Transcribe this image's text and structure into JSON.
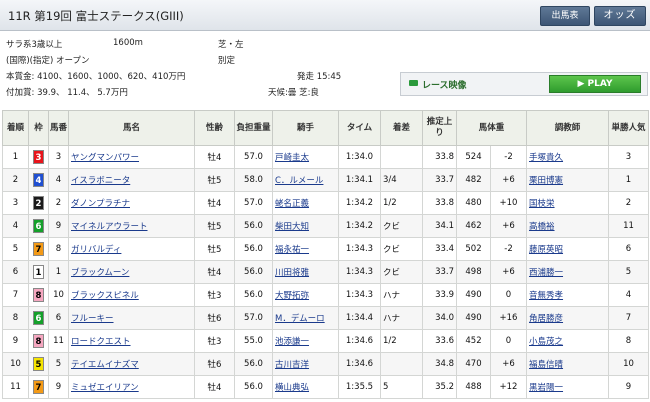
{
  "header": {
    "race_title": "11R 第19回 富士ステークス(GIII)",
    "buttons": {
      "shutuba": "出馬表",
      "odds": "オッズ"
    }
  },
  "race_info": {
    "condition": "サラ系3歳以上",
    "distance": "1600m",
    "course": "芝・左",
    "class": "(国際)(指定) オープン",
    "weight_rule": "別定",
    "prize": "本賞金:  4100、1600、1000、620、410万円",
    "start_time": "発走 15:45",
    "add_prize": "付加賞:   39.9、 11.4、  5.7万円",
    "going": "天候:曇   芝:良"
  },
  "video": {
    "label": "レース映像",
    "play": "PLAY"
  },
  "table": {
    "headers": [
      "着順",
      "枠",
      "馬番",
      "馬名",
      "性齢",
      "負担重量",
      "騎手",
      "タイム",
      "着差",
      "推定上り",
      "馬体重",
      "",
      "調教師",
      "単勝人気"
    ],
    "rows": [
      {
        "rank": "1",
        "waku": "3",
        "umaban": "3",
        "horse": "ヤングマンパワー",
        "sex_age": "牡4",
        "weight": "57.0",
        "jockey": "戸崎圭太",
        "time": "1:34.0",
        "margin": "",
        "last3f": "33.8",
        "body": "524",
        "diff": "-2",
        "trainer": "手塚貴久",
        "pop": "3"
      },
      {
        "rank": "2",
        "waku": "4",
        "umaban": "4",
        "horse": "イスラボニータ",
        "sex_age": "牡5",
        "weight": "58.0",
        "jockey": "C．ルメール",
        "time": "1:34.1",
        "margin": "3/4",
        "last3f": "33.7",
        "body": "482",
        "diff": "+6",
        "trainer": "栗田博憲",
        "pop": "1"
      },
      {
        "rank": "3",
        "waku": "2",
        "umaban": "2",
        "horse": "ダノンプラチナ",
        "sex_age": "牡4",
        "weight": "57.0",
        "jockey": "蛯名正義",
        "time": "1:34.2",
        "margin": "1/2",
        "last3f": "33.8",
        "body": "480",
        "diff": "+10",
        "trainer": "国枝栄",
        "pop": "2"
      },
      {
        "rank": "4",
        "waku": "6",
        "umaban": "9",
        "horse": "マイネルアウラート",
        "sex_age": "牡5",
        "weight": "56.0",
        "jockey": "柴田大知",
        "time": "1:34.2",
        "margin": "クビ",
        "last3f": "34.1",
        "body": "462",
        "diff": "+6",
        "trainer": "高橋裕",
        "pop": "11"
      },
      {
        "rank": "5",
        "waku": "7",
        "umaban": "8",
        "horse": "ガリバルディ",
        "sex_age": "牡5",
        "weight": "56.0",
        "jockey": "福永祐一",
        "time": "1:34.3",
        "margin": "クビ",
        "last3f": "33.4",
        "body": "502",
        "diff": "-2",
        "trainer": "藤原英昭",
        "pop": "6"
      },
      {
        "rank": "6",
        "waku": "1",
        "umaban": "1",
        "horse": "ブラックムーン",
        "sex_age": "牡4",
        "weight": "56.0",
        "jockey": "川田将雅",
        "time": "1:34.3",
        "margin": "クビ",
        "last3f": "33.7",
        "body": "498",
        "diff": "+6",
        "trainer": "西浦勝一",
        "pop": "5"
      },
      {
        "rank": "7",
        "waku": "8",
        "umaban": "10",
        "horse": "ブラックスピネル",
        "sex_age": "牡3",
        "weight": "56.0",
        "jockey": "大野拓弥",
        "time": "1:34.3",
        "margin": "ハナ",
        "last3f": "33.9",
        "body": "490",
        "diff": "0",
        "trainer": "音無秀孝",
        "pop": "4"
      },
      {
        "rank": "8",
        "waku": "6",
        "umaban": "6",
        "horse": "フルーキー",
        "sex_age": "牡6",
        "weight": "57.0",
        "jockey": "M．デムーロ",
        "time": "1:34.4",
        "margin": "ハナ",
        "last3f": "34.0",
        "body": "490",
        "diff": "+16",
        "trainer": "角居勝彦",
        "pop": "7"
      },
      {
        "rank": "9",
        "waku": "8",
        "umaban": "11",
        "horse": "ロードクエスト",
        "sex_age": "牡3",
        "weight": "55.0",
        "jockey": "池添謙一",
        "time": "1:34.6",
        "margin": "1/2",
        "last3f": "33.6",
        "body": "452",
        "diff": "0",
        "trainer": "小島茂之",
        "pop": "8"
      },
      {
        "rank": "10",
        "waku": "5",
        "umaban": "5",
        "horse": "テイエムイナズマ",
        "sex_age": "牡6",
        "weight": "56.0",
        "jockey": "古川吉洋",
        "time": "1:34.6",
        "margin": "",
        "last3f": "34.8",
        "body": "470",
        "diff": "+6",
        "trainer": "福島信晴",
        "pop": "10"
      },
      {
        "rank": "11",
        "waku": "7",
        "umaban": "9",
        "horse": "ミュゼエイリアン",
        "sex_age": "牡4",
        "weight": "56.0",
        "jockey": "横山典弘",
        "time": "1:35.5",
        "margin": "5",
        "last3f": "35.2",
        "body": "488",
        "diff": "+12",
        "trainer": "黒岩陽一",
        "pop": "9"
      }
    ]
  },
  "waku_colors": {
    "1": {
      "bg": "#ffffff",
      "fg": "#000000"
    },
    "2": {
      "bg": "#1a1a1a",
      "fg": "#ffffff"
    },
    "3": {
      "bg": "#e8141b",
      "fg": "#ffffff"
    },
    "4": {
      "bg": "#1f4fd1",
      "fg": "#ffffff"
    },
    "5": {
      "bg": "#f5e400",
      "fg": "#000000"
    },
    "6": {
      "bg": "#14a02a",
      "fg": "#ffffff"
    },
    "7": {
      "bg": "#f39a17",
      "fg": "#000000"
    },
    "8": {
      "bg": "#f6a7c0",
      "fg": "#000000"
    }
  }
}
